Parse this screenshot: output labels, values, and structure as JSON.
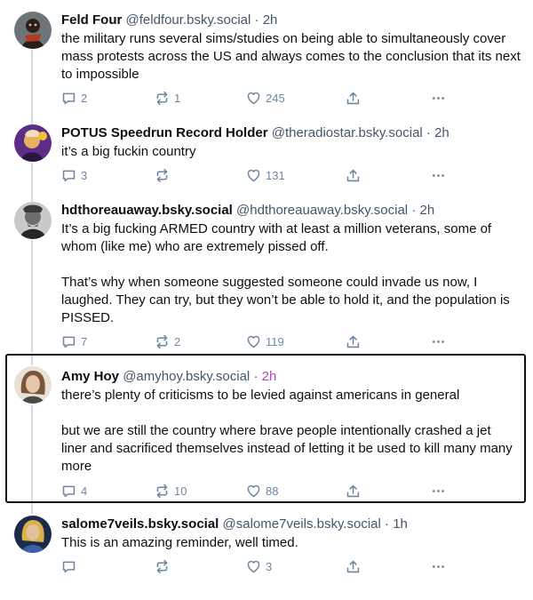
{
  "posts": [
    {
      "name": "Feld Four",
      "handle": "@feldfour.bsky.social",
      "time": "2h",
      "paragraphs": [
        "the military runs several sims/studies on being able to simultaneously cover mass protests across the US and always comes to the conclusion that its next to impossible"
      ],
      "replies": "2",
      "reposts": "1",
      "likes": "245",
      "avatar_icon": "avatar-dark-figure-red-scarf"
    },
    {
      "name": "POTUS Speedrun Record Holder",
      "handle": "@theradiostar.bsky.social",
      "time": "2h",
      "paragraphs": [
        "it’s a big fuckin country"
      ],
      "replies": "3",
      "reposts": "",
      "likes": "131",
      "avatar_icon": "avatar-purple-portrait"
    },
    {
      "name": "hdthoreauaway.bsky.social",
      "handle": "@hdthoreauaway.bsky.social",
      "time": "2h",
      "paragraphs": [
        "It’s a big fucking ARMED country with at least a million veterans, some of whom (like me) who are extremely pissed off.",
        "That’s why when someone suggested someone could invade us now, I laughed. They can try, but they won’t be able to hold it, and the population is PISSED."
      ],
      "replies": "7",
      "reposts": "2",
      "likes": "119",
      "avatar_icon": "avatar-grayscale-portrait"
    },
    {
      "name": "Amy Hoy",
      "handle": "@amyhoy.bsky.social",
      "time": "2h",
      "paragraphs": [
        "there’s plenty of criticisms to be levied against americans in general",
        "but we are still the country where brave people intentionally crashed a jet liner and sacrificed themselves instead of letting it be used to kill many many more"
      ],
      "replies": "4",
      "reposts": "10",
      "likes": "88",
      "avatar_icon": "avatar-photo-woman"
    },
    {
      "name": "salome7veils.bsky.social",
      "handle": "@salome7veils.bsky.social",
      "time": "1h",
      "paragraphs": [
        "This is an amazing reminder, well timed."
      ],
      "replies": "",
      "reposts": "",
      "likes": "3",
      "avatar_icon": "avatar-painted-portrait"
    }
  ],
  "separator": "·",
  "colors": {
    "text": "#0b0f14",
    "muted": "#42576c",
    "icon": "#6f869f",
    "thread_line": "#d4dbe2",
    "highlight_time": "#b44ab4"
  }
}
